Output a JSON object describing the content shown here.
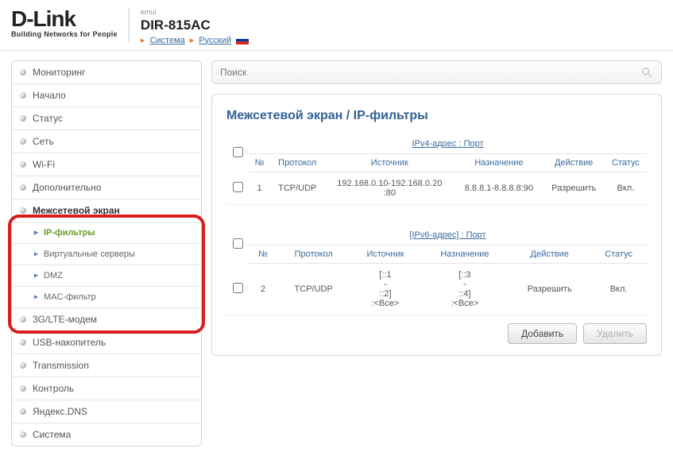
{
  "header": {
    "logo_text": "D-Link",
    "logo_slogan": "Building Networks for People",
    "emul": "emul",
    "model": "DIR-815AC",
    "link_system": "Система",
    "link_lang": "Русский"
  },
  "search": {
    "placeholder": "Поиск"
  },
  "sidebar": {
    "items": [
      {
        "label": "Мониторинг"
      },
      {
        "label": "Начало"
      },
      {
        "label": "Статус"
      },
      {
        "label": "Сеть"
      },
      {
        "label": "Wi-Fi"
      },
      {
        "label": "Дополнительно"
      },
      {
        "label": "Межсетевой экран",
        "active": true,
        "sub": [
          {
            "label": "IP-фильтры",
            "sel": true
          },
          {
            "label": "Виртуальные серверы"
          },
          {
            "label": "DMZ"
          },
          {
            "label": "MAC-фильтр"
          }
        ]
      },
      {
        "label": "3G/LTE-модем"
      },
      {
        "label": "USB-накопитель"
      },
      {
        "label": "Transmission"
      },
      {
        "label": "Контроль"
      },
      {
        "label": "Яндекс.DNS"
      },
      {
        "label": "Система"
      }
    ]
  },
  "page": {
    "title": "Межсетевой экран / IP-фильтры"
  },
  "tables": {
    "headers": {
      "num": "№",
      "proto": "Протокол",
      "src": "Источник",
      "dst": "Назначение",
      "act": "Действие",
      "stat": "Статус"
    },
    "v4": {
      "title": "IPv4-адрес : Порт",
      "rows": [
        {
          "num": "1",
          "proto": "TCP/UDP",
          "src": "192.168.0.10-192.168.0.20\n:80",
          "dst": "8.8.8.1-8.8.8.8:90",
          "act": "Разрешить",
          "stat": "Вкл."
        }
      ]
    },
    "v6": {
      "title": "[IPv6-адрес] : Порт",
      "rows": [
        {
          "num": "2",
          "proto": "TCP/UDP",
          "src": "[::1\n-\n::2]\n:<Все>",
          "dst": "[::3\n-\n::4]\n:<Все>",
          "act": "Разрешить",
          "stat": "Вкл."
        }
      ]
    }
  },
  "buttons": {
    "add": "Добавить",
    "del": "Удалить"
  }
}
